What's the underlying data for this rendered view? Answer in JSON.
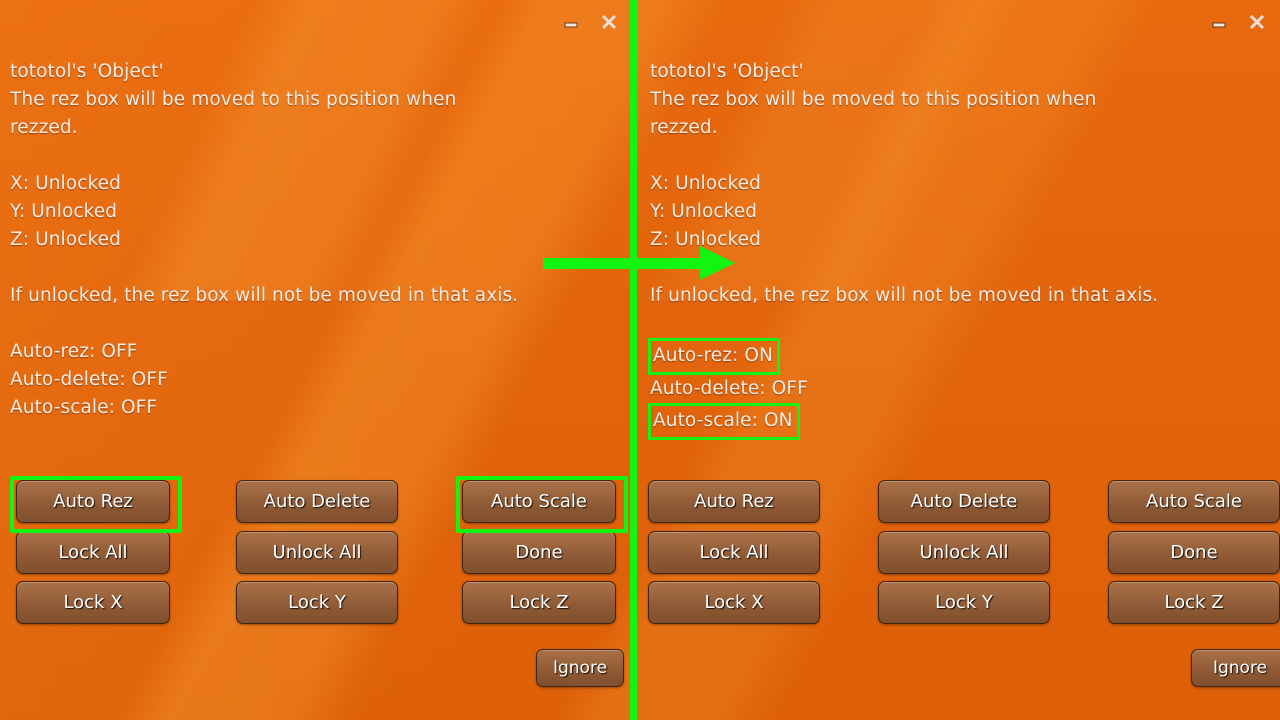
{
  "window": {
    "titlebar": {
      "minimize_label": "minimize",
      "close_label": "close"
    }
  },
  "panels": [
    {
      "id": "before",
      "object_title": "tototol's 'Object'",
      "description_line1": "The rez box will be moved to this position when",
      "description_line2": "rezzed.",
      "axes": [
        {
          "label": "X: Unlocked"
        },
        {
          "label": "Y: Unlocked"
        },
        {
          "label": "Z: Unlocked"
        }
      ],
      "note": "If unlocked, the rez box will not be moved in that axis.",
      "status": [
        {
          "label": "Auto-rez: OFF",
          "highlighted": false
        },
        {
          "label": "Auto-delete: OFF",
          "highlighted": false
        },
        {
          "label": "Auto-scale: OFF",
          "highlighted": false
        }
      ],
      "buttons": [
        {
          "label": "Auto Rez",
          "highlighted": true
        },
        {
          "label": "Auto Delete",
          "highlighted": false
        },
        {
          "label": "Auto Scale",
          "highlighted": true
        },
        {
          "label": "Lock All",
          "highlighted": false
        },
        {
          "label": "Unlock All",
          "highlighted": false
        },
        {
          "label": "Done",
          "highlighted": false
        },
        {
          "label": "Lock X",
          "highlighted": false
        },
        {
          "label": "Lock Y",
          "highlighted": false
        },
        {
          "label": "Lock Z",
          "highlighted": false
        }
      ],
      "ignore_label": "Ignore"
    },
    {
      "id": "after",
      "object_title": "tototol's 'Object'",
      "description_line1": "The rez box will be moved to this position when",
      "description_line2": "rezzed.",
      "axes": [
        {
          "label": "X: Unlocked"
        },
        {
          "label": "Y: Unlocked"
        },
        {
          "label": "Z: Unlocked"
        }
      ],
      "note": "If unlocked, the rez box will not be moved in that axis.",
      "status": [
        {
          "label": "Auto-rez: ON",
          "highlighted": true
        },
        {
          "label": "Auto-delete: OFF",
          "highlighted": false
        },
        {
          "label": "Auto-scale: ON",
          "highlighted": true
        }
      ],
      "buttons": [
        {
          "label": "Auto Rez",
          "highlighted": false
        },
        {
          "label": "Auto Delete",
          "highlighted": false
        },
        {
          "label": "Auto Scale",
          "highlighted": false
        },
        {
          "label": "Lock All",
          "highlighted": false
        },
        {
          "label": "Unlock All",
          "highlighted": false
        },
        {
          "label": "Done",
          "highlighted": false
        },
        {
          "label": "Lock X",
          "highlighted": false
        },
        {
          "label": "Lock Y",
          "highlighted": false
        },
        {
          "label": "Lock Z",
          "highlighted": false
        }
      ],
      "ignore_label": "Ignore"
    }
  ],
  "annotation": {
    "accent_color": "#12f512",
    "divider": "vertical-separator",
    "arrow": "right-arrow"
  },
  "colors": {
    "background_orange": "#e2640c",
    "button_face": "#9d6740",
    "button_border": "#3e2411",
    "text": "#f4ede6",
    "highlight_green": "#12f512"
  }
}
